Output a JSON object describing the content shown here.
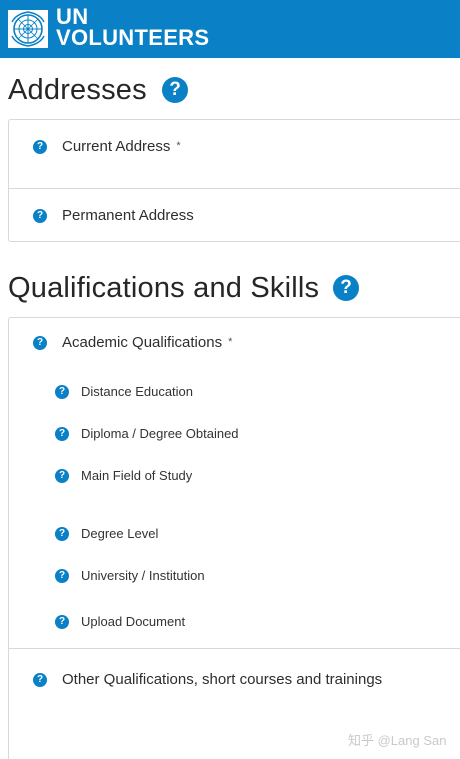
{
  "brand": {
    "line1": "UN",
    "line2": "VOLUNTEERS"
  },
  "sections": {
    "addresses": {
      "title": "Addresses",
      "items": [
        {
          "label": "Current Address",
          "required_mark": "*"
        },
        {
          "label": "Permanent Address"
        }
      ]
    },
    "qualifications": {
      "title": "Qualifications and Skills",
      "academic": {
        "label": "Academic Qualifications",
        "required_mark": "*",
        "fields": [
          "Distance Education",
          "Diploma / Degree Obtained",
          "Main Field of Study",
          "Degree Level",
          "University / Institution",
          "Upload Document"
        ]
      },
      "other": {
        "label": "Other Qualifications, short courses and trainings"
      }
    }
  },
  "help_glyph": "?",
  "watermark": "知乎 @Lang San",
  "colors": {
    "brand_blue": "#0a80c6",
    "border": "#d8d8d8"
  }
}
